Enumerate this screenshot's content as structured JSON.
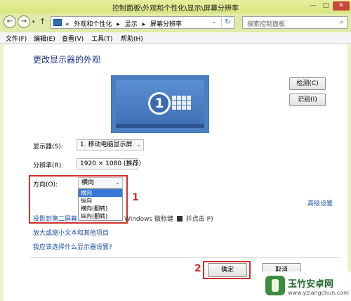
{
  "window": {
    "title": "控制面板\\外观和个性化\\显示\\屏幕分辨率",
    "min_glyph": "—",
    "max_glyph": "□",
    "close_glyph": "✕"
  },
  "nav": {
    "back_glyph": "←",
    "forward_glyph": "→",
    "dropdown_glyph": "▾",
    "up_glyph": "↑",
    "breadcrumbs": [
      "«",
      "外观和个性化",
      "▸",
      "显示",
      "▸",
      "屏幕分辨率"
    ],
    "address_dropdown_glyph": "⌄",
    "refresh_glyph": "↻",
    "search_placeholder": "搜索控制面板",
    "search_glyph": "⌕"
  },
  "menu": {
    "file": "文件(F)",
    "edit": "编辑(E)",
    "view": "查看(V)",
    "tools": "工具(T)",
    "help": "帮助(H)"
  },
  "main": {
    "heading": "更改显示器的外观",
    "monitor_number": "1",
    "detect_button": "检测(C)",
    "identify_button": "识别(I)",
    "display_label": "显示器(S):",
    "display_value": "1. 移动电脑显示屏",
    "resolution_label": "分辨率(R):",
    "resolution_value": "1920 × 1080 (推荐)",
    "orientation_label": "方向(O):",
    "orientation_value": "横向",
    "orientation_options": [
      "横向",
      "纵向",
      "横向(翻转)",
      "纵向(翻转)"
    ],
    "advanced_link": "高级设置",
    "project_link": "投影到第二屏幕",
    "project_tail_a": "Windows 徽标键",
    "project_tail_b": "并点击 P)",
    "text_size_link": "放大或缩小文本和其他项目",
    "choose_settings_link": "我应该选择什么显示器设置?",
    "ok_button": "确定",
    "cancel_button": "取消",
    "caret_glyph": "⌄"
  },
  "annotations": {
    "marker_1": "1",
    "marker_2": "2",
    "color": "#d0302c"
  },
  "watermark": {
    "name": "玉竹安卓网",
    "url": "www.yzlangchun.com"
  }
}
